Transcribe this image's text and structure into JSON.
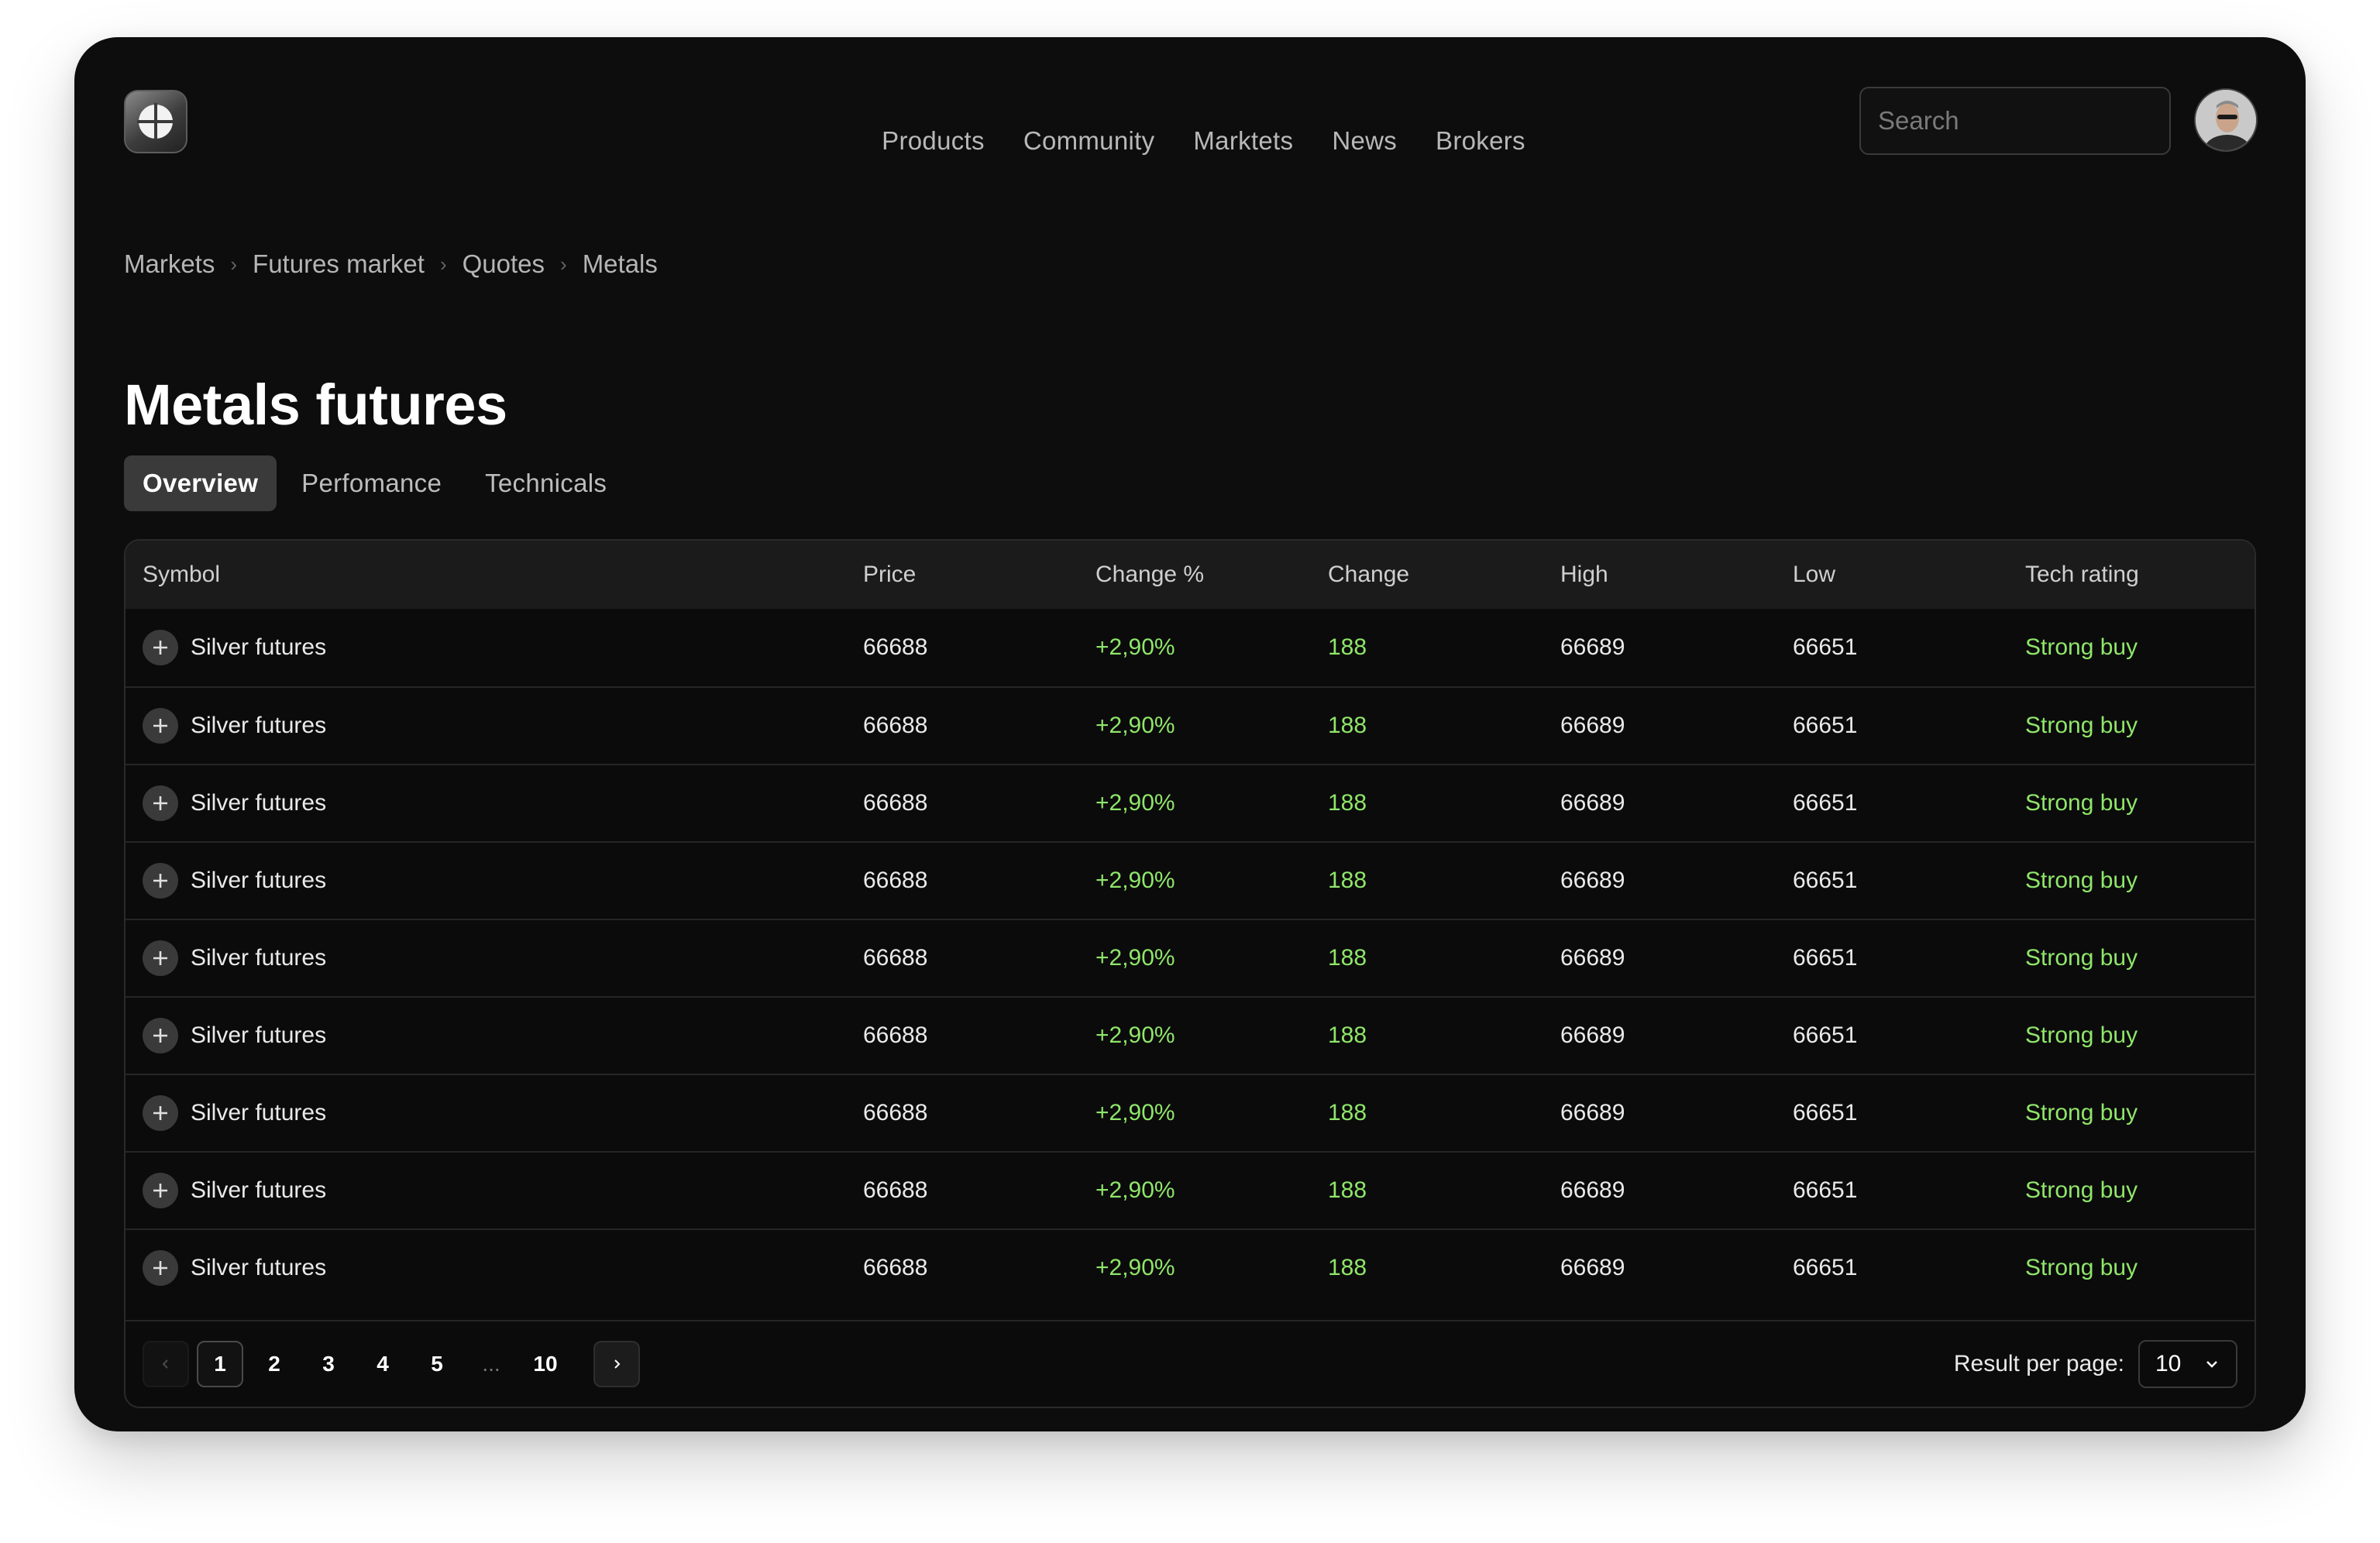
{
  "header": {
    "nav": [
      "Products",
      "Community",
      "Marktets",
      "News",
      "Brokers"
    ],
    "search_placeholder": "Search"
  },
  "breadcrumb": [
    "Markets",
    "Futures market",
    "Quotes",
    "Metals"
  ],
  "page": {
    "title": "Metals futures"
  },
  "tabs": [
    "Overview",
    "Perfomance",
    "Technicals"
  ],
  "table": {
    "columns": [
      "Symbol",
      "Price",
      "Change %",
      "Change",
      "High",
      "Low",
      "Tech rating"
    ],
    "rows": [
      {
        "symbol": "Silver futures",
        "price": "66688",
        "change_pct": "+2,90%",
        "change": "188",
        "high": "66689",
        "low": "66651",
        "rating": "Strong buy"
      },
      {
        "symbol": "Silver futures",
        "price": "66688",
        "change_pct": "+2,90%",
        "change": "188",
        "high": "66689",
        "low": "66651",
        "rating": "Strong buy"
      },
      {
        "symbol": "Silver futures",
        "price": "66688",
        "change_pct": "+2,90%",
        "change": "188",
        "high": "66689",
        "low": "66651",
        "rating": "Strong buy"
      },
      {
        "symbol": "Silver futures",
        "price": "66688",
        "change_pct": "+2,90%",
        "change": "188",
        "high": "66689",
        "low": "66651",
        "rating": "Strong buy"
      },
      {
        "symbol": "Silver futures",
        "price": "66688",
        "change_pct": "+2,90%",
        "change": "188",
        "high": "66689",
        "low": "66651",
        "rating": "Strong buy"
      },
      {
        "symbol": "Silver futures",
        "price": "66688",
        "change_pct": "+2,90%",
        "change": "188",
        "high": "66689",
        "low": "66651",
        "rating": "Strong buy"
      },
      {
        "symbol": "Silver futures",
        "price": "66688",
        "change_pct": "+2,90%",
        "change": "188",
        "high": "66689",
        "low": "66651",
        "rating": "Strong buy"
      },
      {
        "symbol": "Silver futures",
        "price": "66688",
        "change_pct": "+2,90%",
        "change": "188",
        "high": "66689",
        "low": "66651",
        "rating": "Strong buy"
      },
      {
        "symbol": "Silver futures",
        "price": "66688",
        "change_pct": "+2,90%",
        "change": "188",
        "high": "66689",
        "low": "66651",
        "rating": "Strong buy"
      }
    ]
  },
  "pagination": {
    "pages": [
      "1",
      "2",
      "3",
      "4",
      "5",
      "...",
      "10"
    ],
    "current": "1",
    "per_page_label": "Result per page:",
    "per_page_value": "10"
  },
  "colors": {
    "accent_green": "#8fe66a",
    "background": "#0d0d0d"
  },
  "icons": {
    "logo": "logo-icon",
    "search": "search-icon",
    "add": "plus-icon",
    "prev": "chevron-left-icon",
    "next": "chevron-right-icon",
    "dropdown": "chevron-down-icon"
  }
}
